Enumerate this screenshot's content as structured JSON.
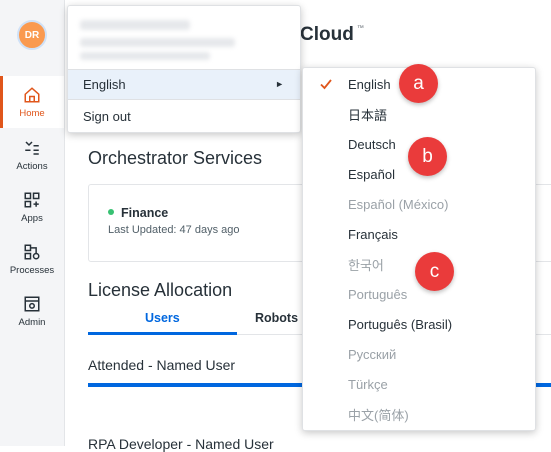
{
  "avatar": {
    "initials": "DR"
  },
  "nav": [
    {
      "label": "Home",
      "icon": "home-icon",
      "active": true
    },
    {
      "label": "Actions",
      "icon": "actions-icon"
    },
    {
      "label": "Apps",
      "icon": "apps-icon"
    },
    {
      "label": "Processes",
      "icon": "processes-icon"
    },
    {
      "label": "Admin",
      "icon": "admin-icon"
    }
  ],
  "page": {
    "cloud_title": "Cloud",
    "trademark": "™",
    "orchestrator_title": "Orchestrator Services",
    "service_name": "Finance",
    "service_updated": "Last Updated: 47 days ago",
    "license_title": "License Allocation",
    "tabs": [
      "Users",
      "Robots"
    ],
    "attended": "Attended - Named User",
    "rpa_dev": "RPA Developer - Named User"
  },
  "profile_menu": {
    "language_label": "English",
    "language_arrow": "►",
    "signout_label": "Sign out"
  },
  "languages": [
    {
      "label": "English",
      "selected": true,
      "enabled": true
    },
    {
      "label": "日本語",
      "enabled": true
    },
    {
      "label": "Deutsch",
      "enabled": true
    },
    {
      "label": "Español",
      "enabled": true
    },
    {
      "label": "Español (México)",
      "enabled": false
    },
    {
      "label": "Français",
      "enabled": true
    },
    {
      "label": "한국어",
      "enabled": false
    },
    {
      "label": "Português",
      "enabled": false
    },
    {
      "label": "Português (Brasil)",
      "enabled": true
    },
    {
      "label": "Русский",
      "enabled": false
    },
    {
      "label": "Türkçe",
      "enabled": false
    },
    {
      "label": "中文(简体)",
      "enabled": false
    }
  ],
  "markers": [
    "a",
    "b",
    "c"
  ],
  "colors": {
    "accent": "#e0561b",
    "primary": "#0067df",
    "marker": "#ea3b3b"
  }
}
